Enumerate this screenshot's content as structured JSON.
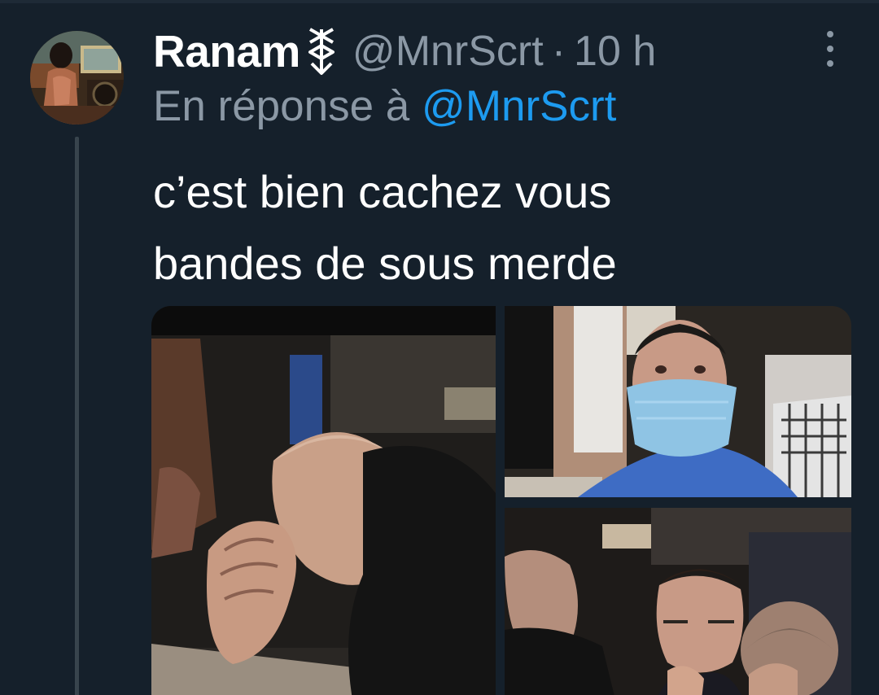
{
  "tweet": {
    "display_name": "Ranam",
    "handle": "@MnrScrt",
    "separator": "·",
    "time": "10 h",
    "reply_prefix": "En réponse à",
    "reply_to": "@MnrScrt",
    "text_line_1": "c’est bien cachez vous",
    "text_line_2": "bandes de sous merde"
  },
  "icons": {
    "more": "more-vertical-icon",
    "name_glyph": "rune-symbol-icon"
  },
  "colors": {
    "background": "#15202b",
    "primary_text": "#ffffff",
    "secondary_text": "#8b98a5",
    "link": "#1d9bf0",
    "thread_line": "#38444d"
  }
}
